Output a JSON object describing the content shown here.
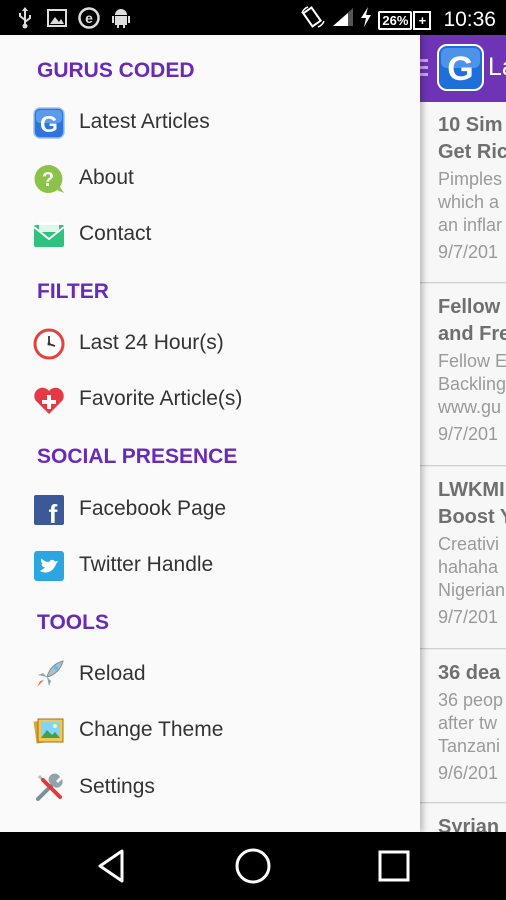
{
  "status_bar": {
    "notification_icons": [
      "usb-icon",
      "image-icon",
      "e-icon",
      "android-icon"
    ],
    "battery": "26%",
    "battery_plus": "+",
    "time": "10:36"
  },
  "action_bar": {
    "title": "La"
  },
  "drawer": {
    "sections": [
      {
        "title": "GURUS CODED",
        "items": [
          {
            "label": "Latest Articles",
            "icon": "google-g-icon"
          },
          {
            "label": "About",
            "icon": "question-icon"
          },
          {
            "label": "Contact",
            "icon": "mail-icon"
          }
        ]
      },
      {
        "title": "FILTER",
        "items": [
          {
            "label": "Last 24 Hour(s)",
            "icon": "clock-icon"
          },
          {
            "label": "Favorite Article(s)",
            "icon": "heart-plus-icon"
          }
        ]
      },
      {
        "title": "SOCIAL PRESENCE",
        "items": [
          {
            "label": "Facebook Page",
            "icon": "facebook-icon"
          },
          {
            "label": "Twitter Handle",
            "icon": "twitter-icon"
          }
        ]
      },
      {
        "title": "TOOLS",
        "items": [
          {
            "label": "Reload",
            "icon": "rocket-icon"
          },
          {
            "label": "Change Theme",
            "icon": "picture-icon"
          },
          {
            "label": "Settings",
            "icon": "tools-icon"
          }
        ]
      }
    ]
  },
  "feed": {
    "articles": [
      {
        "title_lines": [
          "10 Sim",
          "Get Ric"
        ],
        "desc_lines": [
          "Pimples",
          "which a",
          "an inflar"
        ],
        "date": "9/7/201"
      },
      {
        "title_lines": [
          "Fellow",
          "and Fre"
        ],
        "desc_lines": [
          "Fellow E",
          "Backling",
          "www.gu"
        ],
        "date": "9/7/201"
      },
      {
        "title_lines": [
          "LWKMI",
          "Boost Y"
        ],
        "desc_lines": [
          "Creativi",
          "hahaha",
          "Nigerian"
        ],
        "date": "9/7/201"
      },
      {
        "title_lines": [
          "36 dea"
        ],
        "desc_lines": [
          "36 peop",
          "after tw",
          "Tanzani"
        ],
        "date": "9/6/201"
      },
      {
        "title_lines": [
          "Syrian"
        ],
        "desc_lines": [],
        "date": ""
      }
    ]
  },
  "nav_bar": {
    "buttons": [
      "back-icon",
      "home-icon",
      "recents-icon"
    ]
  },
  "colors": {
    "accent": "#6a2ab8",
    "action_bar": "#6f34b6"
  }
}
